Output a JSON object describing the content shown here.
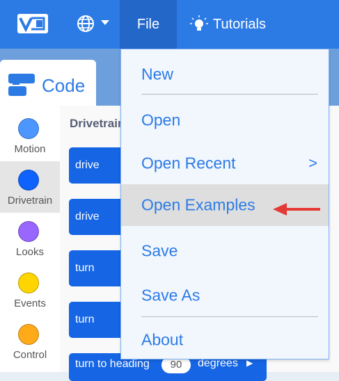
{
  "header": {
    "file_label": "File",
    "tutorials_label": "Tutorials"
  },
  "code_tab": {
    "label": "Code"
  },
  "categories": [
    {
      "label": "Motion",
      "color": "#4c97ff"
    },
    {
      "label": "Drivetrain",
      "color": "#0f62fe"
    },
    {
      "label": "Looks",
      "color": "#9966ff"
    },
    {
      "label": "Events",
      "color": "#ffd500"
    },
    {
      "label": "Control",
      "color": "#ffab19"
    }
  ],
  "palette": {
    "title": "Drivetrain",
    "blocks": [
      {
        "text": "drive"
      },
      {
        "text": "drive"
      },
      {
        "text": "turn"
      },
      {
        "text": "turn"
      },
      {
        "text": "turn to heading",
        "value": "90",
        "suffix": "degrees"
      }
    ]
  },
  "file_menu": {
    "items": [
      {
        "label": "New"
      },
      {
        "label": "Open"
      },
      {
        "label": "Open Recent",
        "arrow": ">"
      },
      {
        "label": "Open Examples"
      },
      {
        "label": "Save"
      },
      {
        "label": "Save As"
      },
      {
        "label": "About"
      }
    ]
  },
  "colors": {
    "header_bg": "#2c7be5",
    "active_tab_bg": "#2367c9",
    "menu_text": "#2c7be5",
    "annotation_arrow": "#e53935"
  }
}
